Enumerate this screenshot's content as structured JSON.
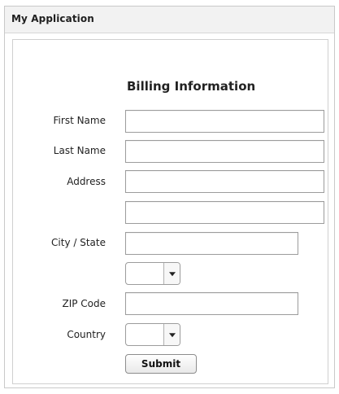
{
  "app": {
    "title": "My Application"
  },
  "form": {
    "heading": "Billing Information",
    "labels": {
      "first_name": "First Name",
      "last_name": "Last Name",
      "address": "Address",
      "city_state": "City / State",
      "zip_code": "ZIP Code",
      "country": "Country"
    },
    "fields": {
      "first_name": "",
      "last_name": "",
      "address_line_1": "",
      "address_line_2": "",
      "city": "",
      "state": "",
      "zip_code": "",
      "country": ""
    },
    "submit_label": "Submit"
  },
  "icons": {
    "state_dropdown": "chevron-down-icon",
    "country_dropdown": "chevron-down-icon"
  },
  "colors": {
    "background": "#ffffff",
    "border": "#c9c9c9",
    "input_border": "#9c9c9c",
    "text": "#222222"
  }
}
